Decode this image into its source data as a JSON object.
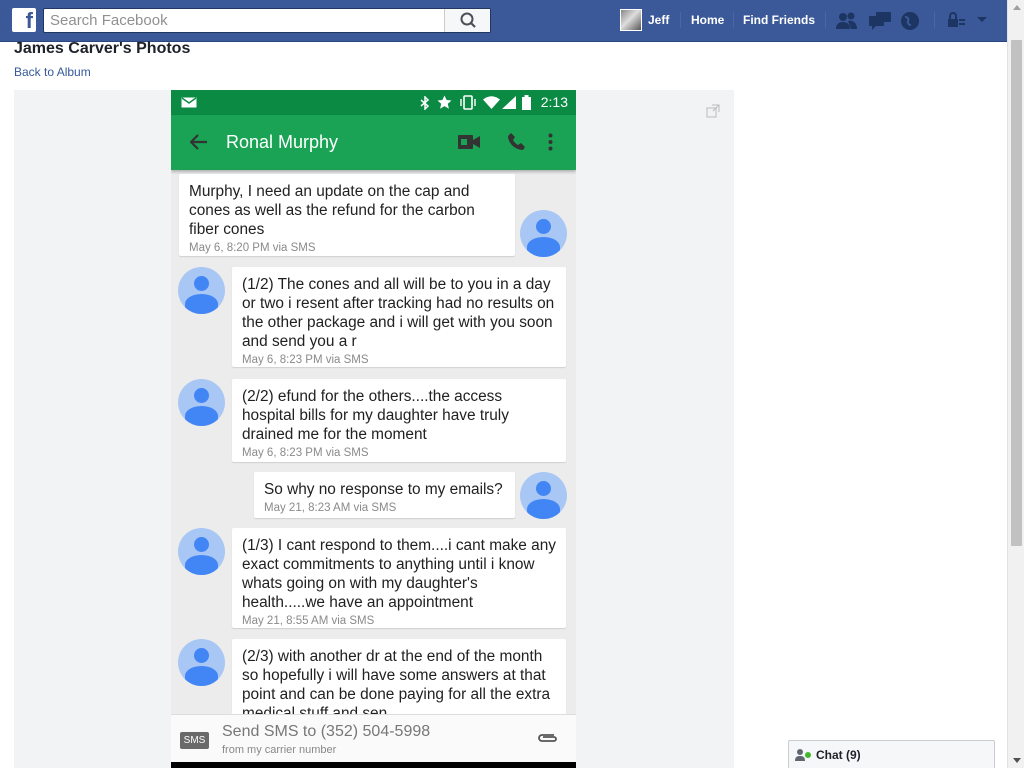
{
  "topbar": {
    "search_placeholder": "Search Facebook",
    "user_name": "Jeff",
    "home": "Home",
    "find_friends": "Find Friends"
  },
  "album": {
    "owner_title": "James Carver's Photos",
    "back_link": "Back to Album"
  },
  "phone": {
    "status_time": "2:13",
    "contact_name": "Ronal Murphy",
    "messages": [
      {
        "direction": "out",
        "text": "Murphy, I need an update on the cap and cones as well as the refund for the carbon fiber cones",
        "meta": "May 6, 8:20 PM via SMS"
      },
      {
        "direction": "in",
        "text": "(1/2) The cones and all will be to you in a day or two i resent after tracking had no results on the other package and i will get with you soon and send you a r",
        "meta": "May 6, 8:23 PM via SMS"
      },
      {
        "direction": "in",
        "text": "(2/2) efund for the others....the access hospital bills for my daughter  have truly drained me for the moment",
        "meta": "May 6, 8:23 PM via SMS"
      },
      {
        "direction": "out",
        "text": "So why no response to my emails?",
        "meta": "May 21, 8:23 AM via SMS"
      },
      {
        "direction": "in",
        "text": "(1/3) I cant respond to them....i cant make any exact commitments to anything until i know whats going on with my daughter's health.....we have an appointment",
        "meta": "May 21, 8:55 AM via SMS"
      },
      {
        "direction": "in",
        "text": "(2/3) with another dr at the end of the month so hopefully i will have some answers at that point and can be done paying for all the extra medical stuff and sen",
        "meta": ""
      }
    ],
    "composer": {
      "badge": "SMS",
      "placeholder": "Send SMS to (352) 504-5998",
      "subtext": "from my carrier number"
    }
  },
  "chat": {
    "label": "Chat (9)"
  },
  "colors": {
    "facebook_blue": "#3b5998",
    "app_green": "#1aa355",
    "status_green": "#0b8a43",
    "avatar_blue": "#4285f4"
  }
}
